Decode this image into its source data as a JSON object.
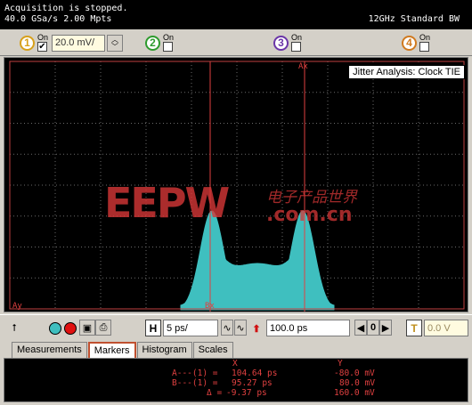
{
  "status": {
    "line1": "Acquisition is stopped.",
    "line2": "40.0 GSa/s   2.00 Mpts",
    "bandwidth": "12GHz Standard BW"
  },
  "channels": [
    {
      "number": "1",
      "on_label": "On",
      "checked": true,
      "scale": "20.0 mV/",
      "color": "#d7a01b"
    },
    {
      "number": "2",
      "on_label": "On",
      "checked": false,
      "color": "#2e9b2e"
    },
    {
      "number": "3",
      "on_label": "On",
      "checked": false,
      "color": "#6b35a8"
    },
    {
      "number": "4",
      "on_label": "On",
      "checked": false,
      "color": "#d07a20"
    }
  ],
  "display": {
    "analysis_label": "Jitter Analysis: Clock TIE",
    "trace_color": "#3fbfbf",
    "marker_color": "#e04040",
    "grid_color": "#6a6a6a",
    "marker_labels": {
      "ax": "Ax",
      "ay": "Ay",
      "bx": "Bx"
    },
    "watermark": {
      "logo": "EEPW",
      "cn": "电子产品世界",
      "url": ".com.cn"
    }
  },
  "toolbar": {
    "h_label": "H",
    "timebase": "5 ps/",
    "delay": "100.0 ps",
    "zero": "0",
    "t_label": "T",
    "trigger_level": "0.0 V"
  },
  "tabs": [
    "Measurements",
    "Markers",
    "Histogram",
    "Scales"
  ],
  "active_tab": "Markers",
  "markers": {
    "col_x": "X",
    "col_y": "Y",
    "rows": [
      {
        "label": "A---(1) =",
        "x": "104.64 ps",
        "y": "-80.0 mV"
      },
      {
        "label": "B---(1) =",
        "x": "95.27 ps",
        "y": "80.0 mV"
      },
      {
        "label": "Δ =",
        "x": "-9.37 ps",
        "y": "160.0 mV"
      }
    ]
  }
}
